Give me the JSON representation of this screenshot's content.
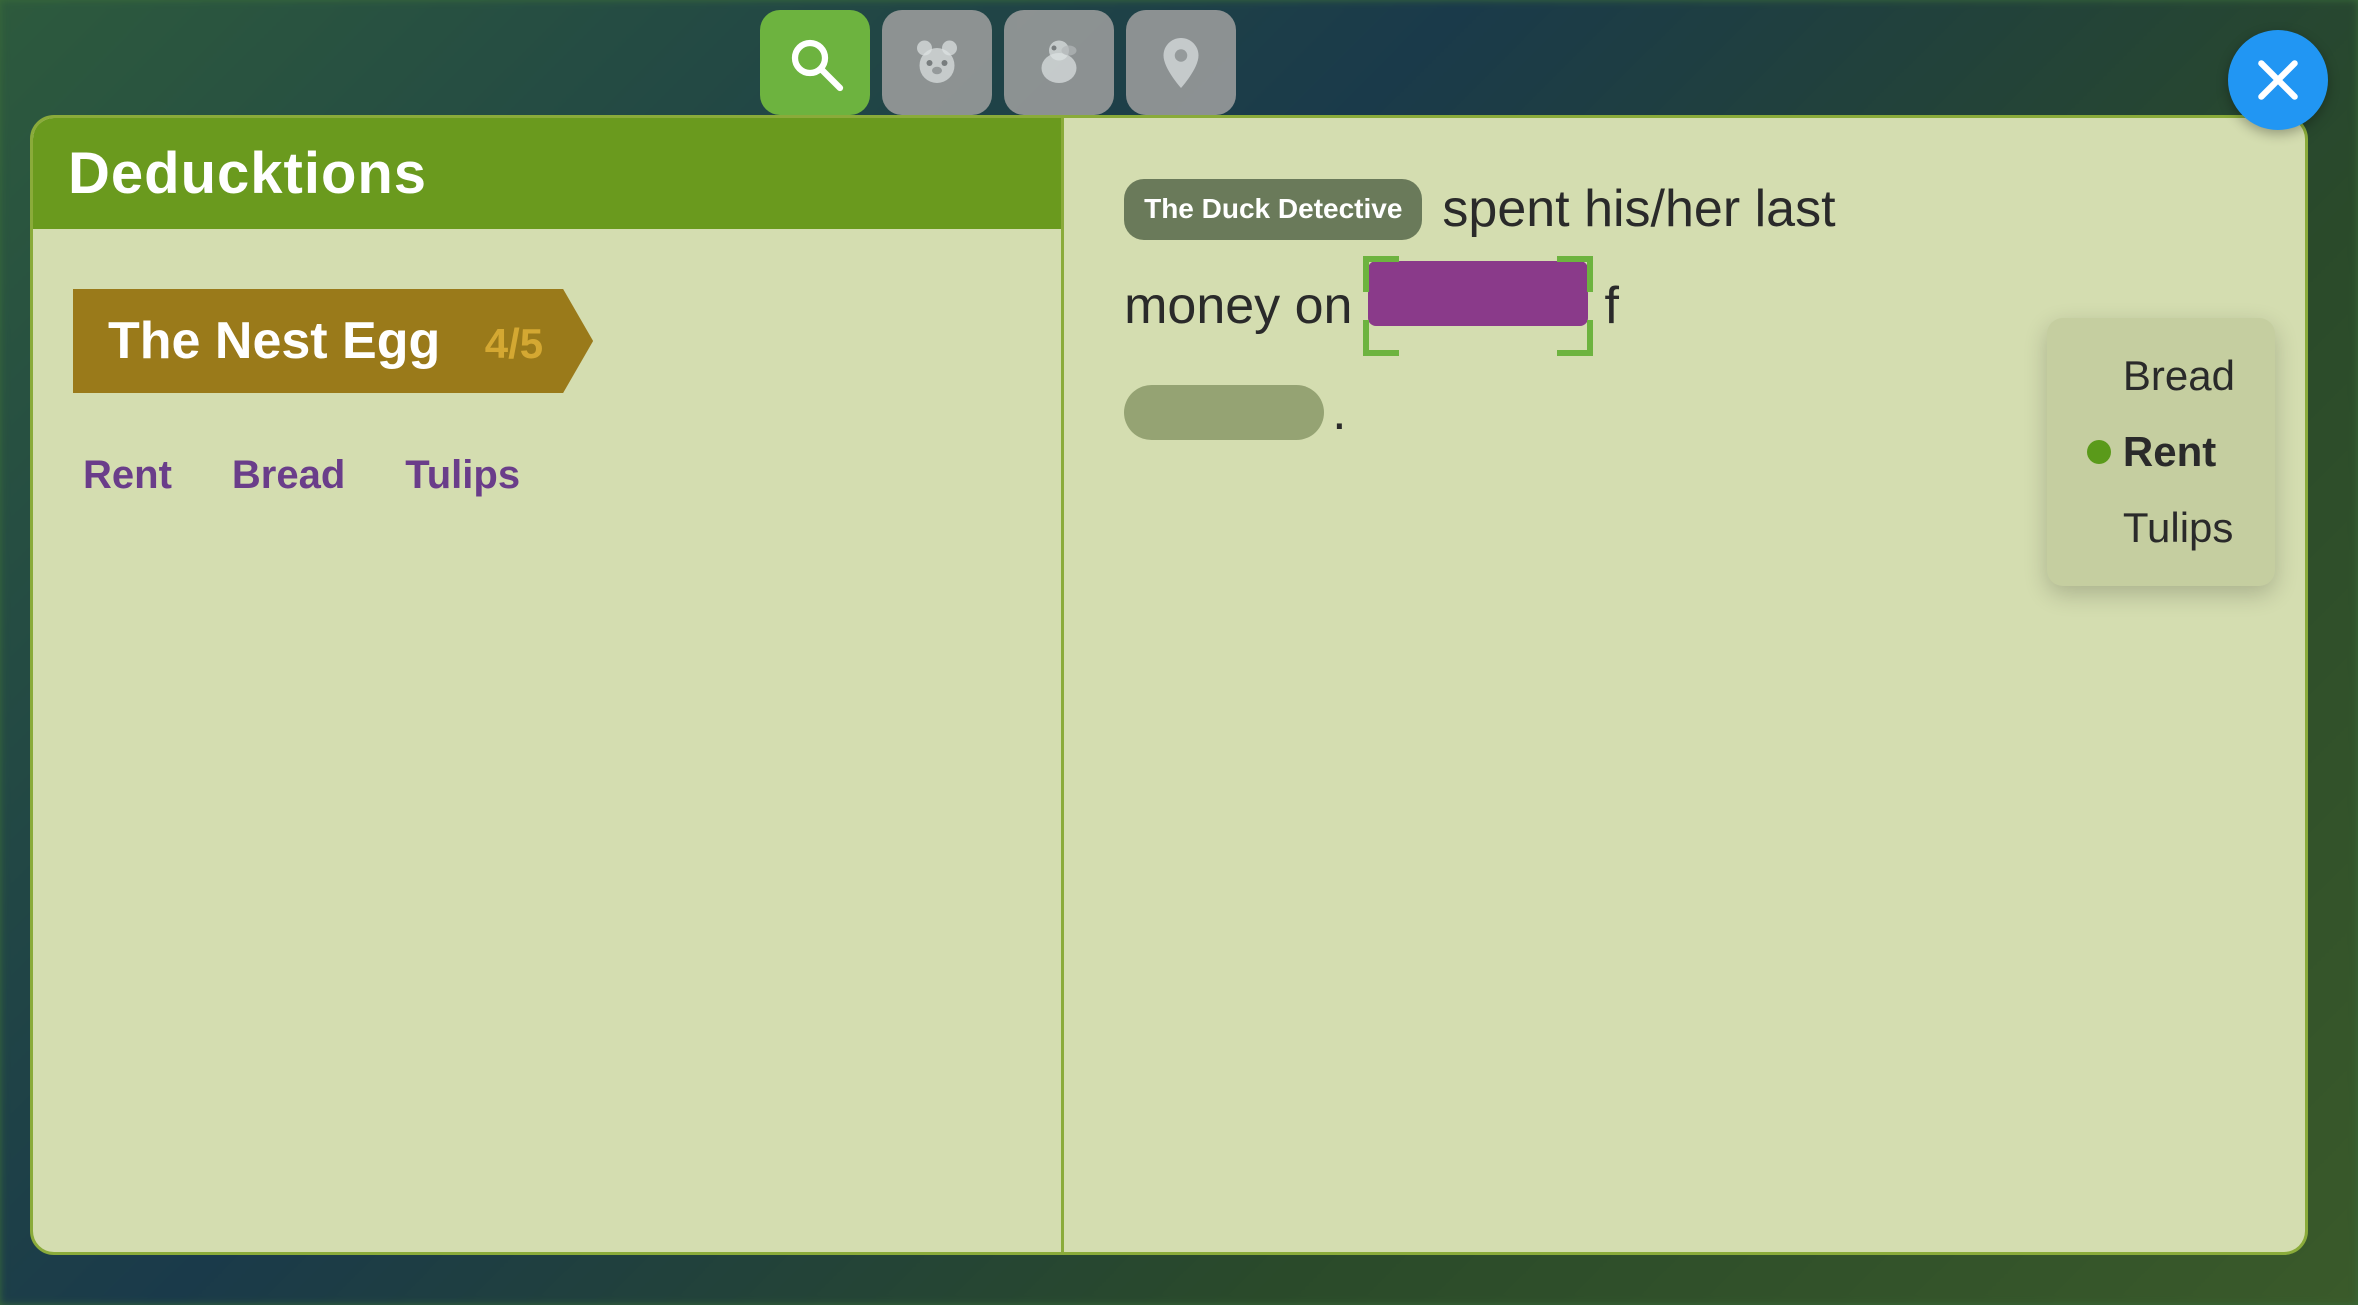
{
  "app": {
    "title": "Duck Detective - Deducktions"
  },
  "background": {
    "color": "#3a6b3a"
  },
  "topNav": {
    "buttons": [
      {
        "id": "search",
        "label": "Search",
        "active": true,
        "icon": "search"
      },
      {
        "id": "bear",
        "label": "Bear character",
        "active": false,
        "icon": "bear"
      },
      {
        "id": "duck",
        "label": "Duck character",
        "active": false,
        "icon": "duck"
      },
      {
        "id": "location",
        "label": "Location",
        "active": false,
        "icon": "location"
      }
    ]
  },
  "closeButton": {
    "label": "×"
  },
  "leftPage": {
    "title": "Deducktions",
    "chapter": {
      "name": "The Nest Egg",
      "progress": "4/5"
    },
    "tags": [
      "Rent",
      "Bread",
      "Tulips"
    ]
  },
  "rightPage": {
    "badge": "The Duck Detective",
    "sentencePart1": "spent his/her last",
    "sentencePart2": "money on",
    "blankText": "",
    "sentencePart3": "f",
    "secondBlankText": "",
    "periodText": "."
  },
  "dropdown": {
    "items": [
      {
        "label": "Bread",
        "selected": false
      },
      {
        "label": "Rent",
        "selected": true
      },
      {
        "label": "Tulips",
        "selected": false
      }
    ]
  }
}
